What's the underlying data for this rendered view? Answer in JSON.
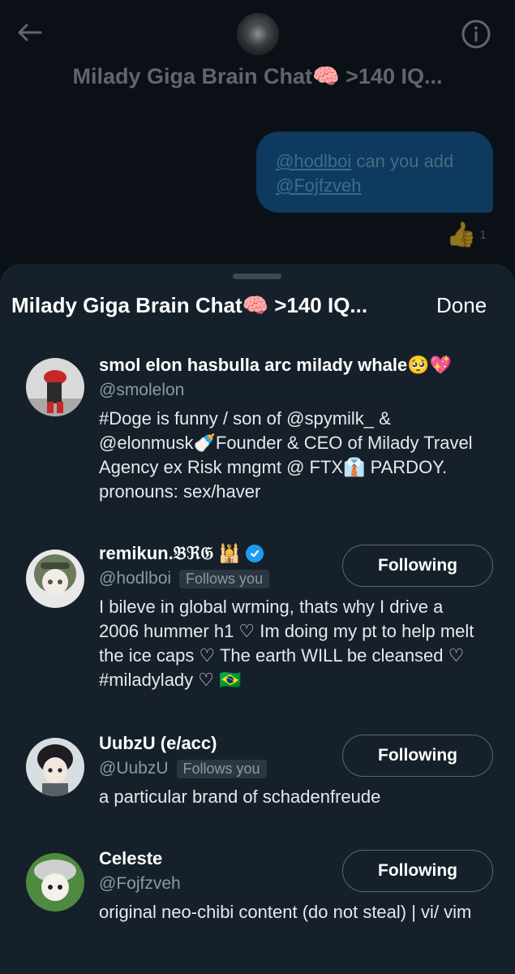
{
  "background_chat": {
    "title": "Milady Giga Brain Chat🧠 >140 IQ...",
    "message": {
      "mention1": "@hodlboi",
      "text": " can you add ",
      "mention2": "@Fojfzveh"
    },
    "reaction": {
      "emoji": "👍",
      "count": "1"
    }
  },
  "sheet": {
    "title": "Milady Giga Brain Chat🧠 >140 IQ...",
    "done_label": "Done"
  },
  "members": [
    {
      "name": "smol elon hasbulla arc milady whale🥺💖",
      "handle": "@smolelon",
      "follows_you": "",
      "bio": "#Doge is funny / son of @spymilk_ & @elonmusk🍼Founder & CEO of Milady Travel Agency ex Risk mngmt @ FTX👔 PARDOY. pronouns: sex/haver",
      "button": ""
    },
    {
      "name": "remikun.𝔅ℜ𝔊 🕌",
      "handle": "@hodlboi",
      "follows_you": "Follows you",
      "bio": "I bileve in global wrming, thats why I drive a 2006 hummer h1 ♡ Im doing my pt to help melt the ice caps ♡ The earth WILL be cleansed ♡ #miladylady ♡ 🇧🇷",
      "button": "Following"
    },
    {
      "name": "UubzU (e/acc)",
      "handle": "@UubzU",
      "follows_you": "Follows you",
      "bio": "a particular brand of schadenfreude",
      "button": "Following"
    },
    {
      "name": "Celeste",
      "handle": "@Fojfzveh",
      "follows_you": "",
      "bio": "original neo-chibi content (do not steal) | vi/ vim",
      "button": "Following"
    }
  ],
  "colors": {
    "sheet_bg": "#15202b",
    "bubble": "#0d3a5e",
    "verified": "#1d9bf0"
  }
}
